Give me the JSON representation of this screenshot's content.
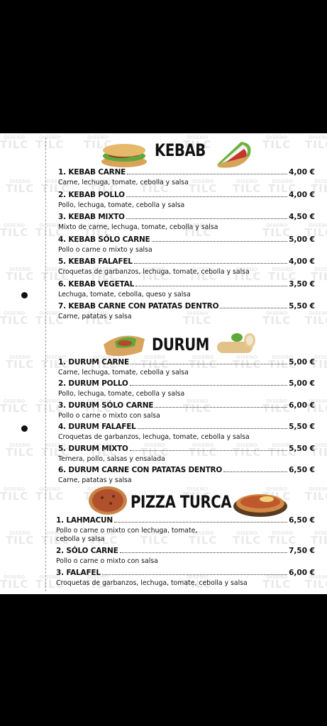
{
  "watermark": "TILC",
  "watermark_small": "DISEÑO",
  "sections": {
    "kebab": {
      "title": "KEBAB",
      "items": [
        {
          "name": "1. KEBAB CARNE",
          "price": "4,00 €",
          "desc": "Carne, lechuga, tomate, cebolla y salsa"
        },
        {
          "name": "2. KEBAB POLLO",
          "price": "4,00 €",
          "desc": "Pollo, lechuga, tomate, cebolla y salsa"
        },
        {
          "name": "3. KEBAB MIXTO",
          "price": "4,50 €",
          "desc": "Mixto de carne, lechuga, tomate, cebolla y salsa"
        },
        {
          "name": "4. KEBAB SÓLO CARNE",
          "price": "5,00 €",
          "desc": "Pollo o carne o mixto y salsa"
        },
        {
          "name": "5. KEBAB FALAFEL",
          "price": "4,00 €",
          "desc": "Croquetas de garbanzos, lechuga, tomate, cebolla y salsa"
        },
        {
          "name": "6. KEBAB VEGETAL",
          "price": "3,50 €",
          "desc": "Lechuga, tomate, cebolla, queso y salsa"
        },
        {
          "name": "7. KEBAB CARNE CON PATATAS DENTRO",
          "price": "5,50 €",
          "desc": "Carne, patatas y salsa"
        }
      ]
    },
    "durum": {
      "title": "DURUM",
      "items": [
        {
          "name": "1. DURUM CARNE",
          "price": "5,00 €",
          "desc": "Carne, lechuga, tomate, cebolla y salsa"
        },
        {
          "name": "2. DURUM POLLO",
          "price": "5,00 €",
          "desc": "Pollo, lechuga, tomate, cebolla y salsa"
        },
        {
          "name": "3. DURUM SÓLO CARNE",
          "price": "6,00 €",
          "desc": "Pollo o carne o mixto con salsa"
        },
        {
          "name": "4. DURUM FALAFEL",
          "price": "5,50 €",
          "desc": "Croquetas de garbanzos, lechuga, tomate, cebolla y salsa"
        },
        {
          "name": "5. DURUM MIXTO",
          "price": "5,50 €",
          "desc": "Ternera, pollo, salsas y ensalada"
        },
        {
          "name": "6. DURUM CARNE CON PATATAS DENTRO",
          "price": "6,50 €",
          "desc": "Carne, patatas y salsa"
        }
      ]
    },
    "pizza": {
      "title": "PIZZA TURCA",
      "items": [
        {
          "name": "1. LAHMACUN",
          "price": "6,50 €",
          "desc": "Pollo o carne o mixto con lechuga, tomate,",
          "desc2": "cebolla y salsa"
        },
        {
          "name": "2. SÓLO CARNE",
          "price": "7,50 €",
          "desc": "Pollo o carne o mixto con salsa"
        },
        {
          "name": "3. FALAFEL",
          "price": "6,00 €",
          "desc": "Croquetas de garbanzos, lechuga, tomate, cebolla y salsa"
        }
      ]
    }
  },
  "colors": {
    "background": "#000000",
    "paper": "#ffffff",
    "text": "#111111",
    "watermark": "#e9e9e9"
  },
  "images": [
    "kebab-sandwich-image",
    "kebab-wrap-image",
    "durum-roll-image",
    "durum-cut-image",
    "lahmacun-image",
    "pizza-turca-image"
  ]
}
